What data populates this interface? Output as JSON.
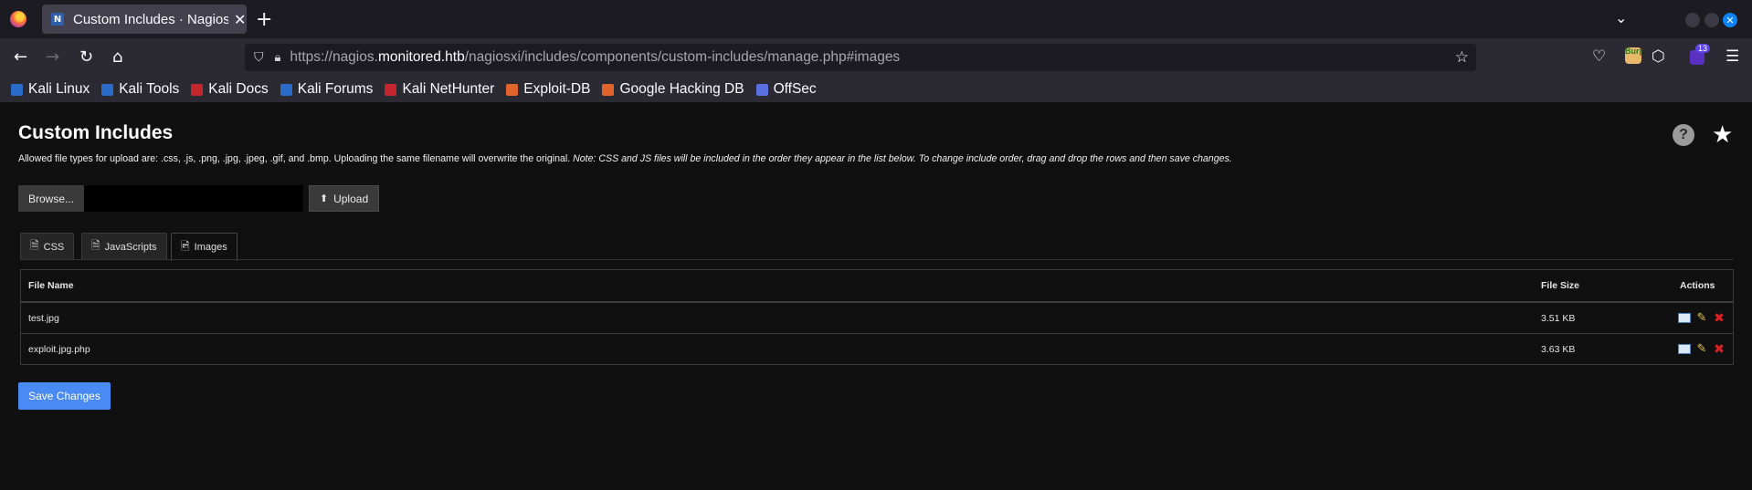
{
  "browser": {
    "tab_title": "Custom Includes · Nagios",
    "tab_favicon": "N",
    "new_tab_label": "+",
    "url_prefix": "https://nagios.",
    "url_host": "monitored.htb",
    "url_path": "/nagiosxi/includes/components/custom-includes/manage.php#images",
    "extension_label": "Burp",
    "extension_badge": "13"
  },
  "bookmarks": [
    {
      "label": "Kali Linux",
      "color": "#2a6cc9"
    },
    {
      "label": "Kali Tools",
      "color": "#2a6cc9"
    },
    {
      "label": "Kali Docs",
      "color": "#c4262e"
    },
    {
      "label": "Kali Forums",
      "color": "#2a6cc9"
    },
    {
      "label": "Kali NetHunter",
      "color": "#c4262e"
    },
    {
      "label": "Exploit-DB",
      "color": "#e0632b"
    },
    {
      "label": "Google Hacking DB",
      "color": "#e0632b"
    },
    {
      "label": "OffSec",
      "color": "#5a6fe0"
    }
  ],
  "page": {
    "title": "Custom Includes",
    "help_label": "?",
    "description_plain": "Allowed file types for upload are: .css, .js, .png, .jpg, .jpeg, .gif, and .bmp. Uploading the same filename will overwrite the original. ",
    "description_note": "Note: CSS and JS files will be included in the order they appear in the list below. To change include order, drag and drop the rows and then save changes.",
    "browse_label": "Browse...",
    "upload_label": "Upload",
    "tabs": [
      {
        "label": "CSS",
        "icon": "file-css-icon"
      },
      {
        "label": "JavaScripts",
        "icon": "file-code-icon"
      },
      {
        "label": "Images",
        "icon": "file-image-icon"
      }
    ],
    "active_tab": "Images",
    "table": {
      "headers": {
        "name": "File Name",
        "size": "File Size",
        "actions": "Actions"
      },
      "rows": [
        {
          "name": "test.jpg",
          "size": "3.51 KB"
        },
        {
          "name": "exploit.jpg.php",
          "size": "3.63 KB"
        }
      ]
    },
    "save_label": "Save Changes"
  },
  "colors": {
    "page_bg": "#101011",
    "accent": "#4a8af4",
    "delete": "#e02020"
  }
}
